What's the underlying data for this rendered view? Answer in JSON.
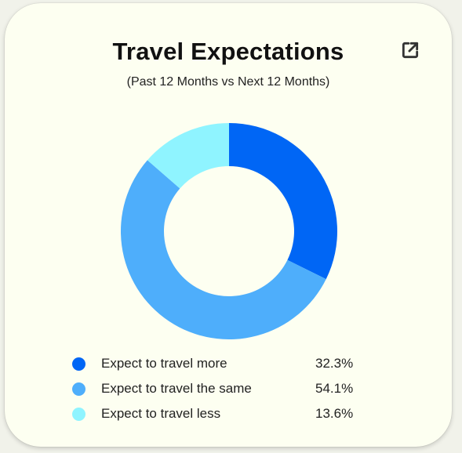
{
  "chart_data": {
    "type": "pie",
    "title": "Travel Expectations",
    "subtitle": "(Past 12 Months vs Next 12 Months)",
    "donut": true,
    "legend_position": "bottom",
    "series": [
      {
        "name": "Expect to travel more",
        "value": 32.3,
        "value_label": "32.3%",
        "color": "#0066f5"
      },
      {
        "name": "Expect to travel the same",
        "value": 54.1,
        "value_label": "54.1%",
        "color": "#4eaefb"
      },
      {
        "name": "Expect to travel less",
        "value": 13.6,
        "value_label": "13.6%",
        "color": "#8ff4ff"
      }
    ]
  },
  "icons": {
    "open_external": "open-in-new-icon"
  }
}
